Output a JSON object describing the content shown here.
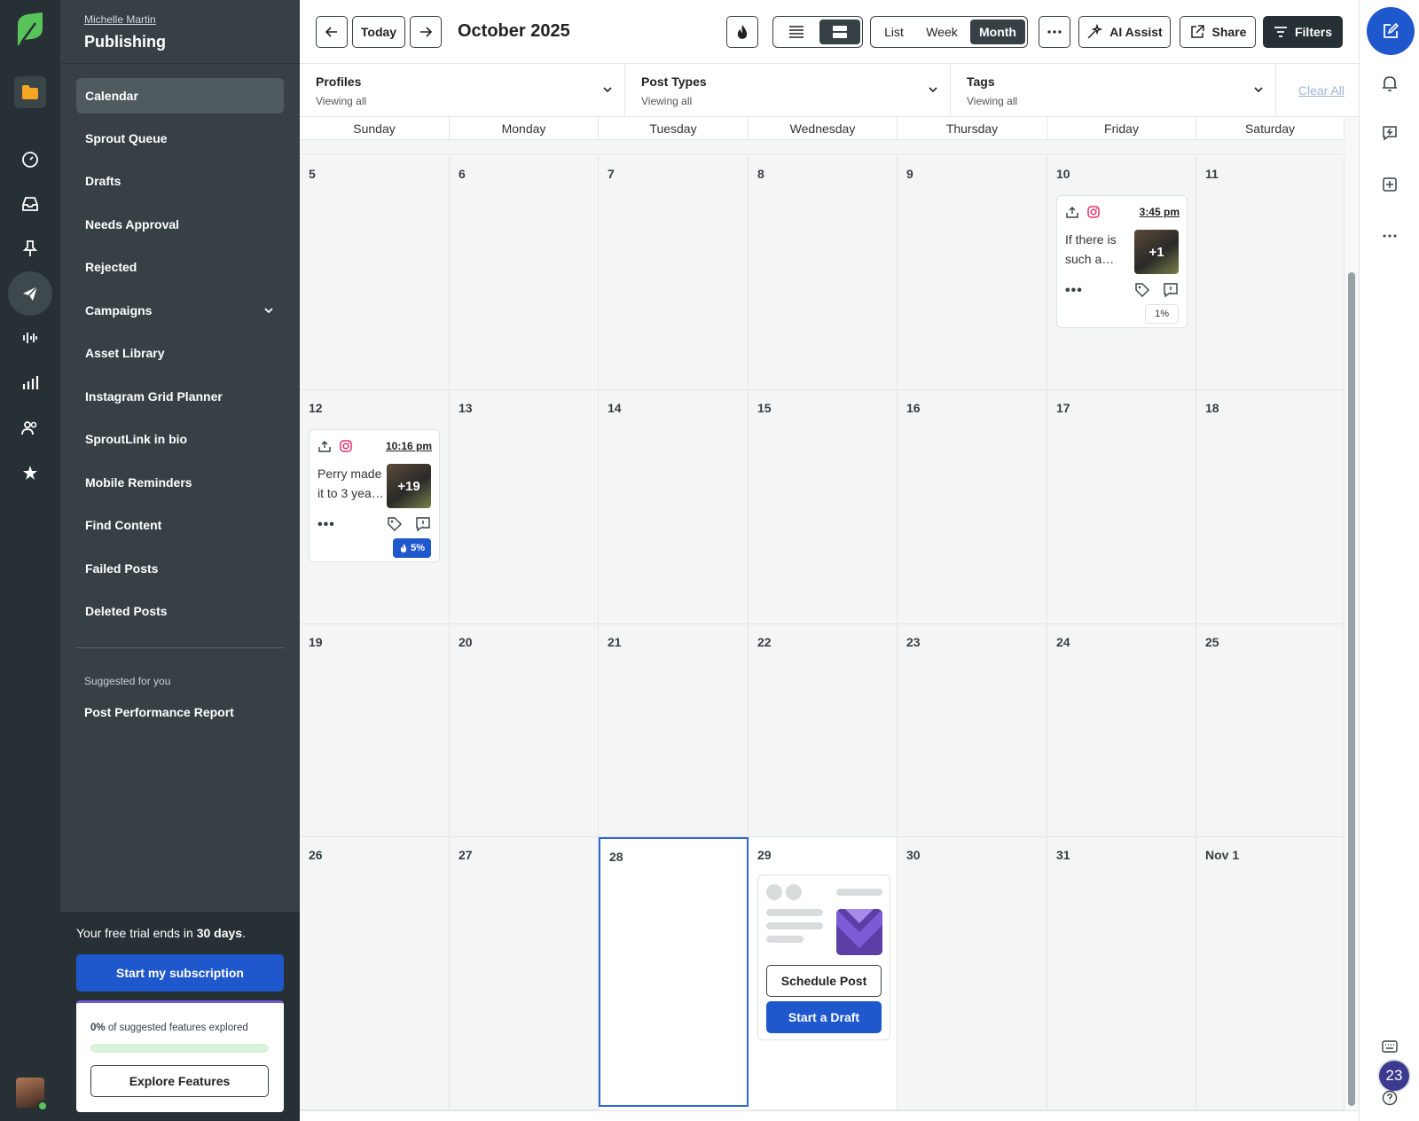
{
  "user": {
    "name": "Michelle Martin"
  },
  "sidebar": {
    "title": "Publishing",
    "items": [
      {
        "label": "Calendar"
      },
      {
        "label": "Sprout Queue"
      },
      {
        "label": "Drafts"
      },
      {
        "label": "Needs Approval"
      },
      {
        "label": "Rejected"
      },
      {
        "label": "Campaigns"
      },
      {
        "label": "Asset Library"
      },
      {
        "label": "Instagram Grid Planner"
      },
      {
        "label": "SproutLink in bio"
      },
      {
        "label": "Mobile Reminders"
      },
      {
        "label": "Find Content"
      },
      {
        "label": "Failed Posts"
      },
      {
        "label": "Deleted Posts"
      }
    ],
    "suggested_label": "Suggested for you",
    "suggested_item": "Post Performance Report"
  },
  "trial": {
    "prefix": "Your free trial ends in ",
    "days": "30 days",
    "suffix": ".",
    "subscribe_label": "Start my subscription",
    "explored_pct": "0%",
    "explored_rest": " of suggested features explored",
    "explored_value": 0,
    "explore_label": "Explore Features"
  },
  "toolbar": {
    "today_label": "Today",
    "title": "October 2025",
    "view_options": [
      "List",
      "Week",
      "Month"
    ],
    "selected_view": "Month",
    "ai_assist_label": "AI Assist",
    "share_label": "Share",
    "filters_label": "Filters"
  },
  "filters": [
    {
      "label": "Profiles",
      "sub": "Viewing all"
    },
    {
      "label": "Post Types",
      "sub": "Viewing all"
    },
    {
      "label": "Tags",
      "sub": "Viewing all"
    }
  ],
  "clear_all_label": "Clear All",
  "calendar": {
    "weekdays": [
      "Sunday",
      "Monday",
      "Tuesday",
      "Wednesday",
      "Thursday",
      "Friday",
      "Saturday"
    ],
    "weeks": [
      [
        "5",
        "6",
        "7",
        "8",
        "9",
        "10",
        "11"
      ],
      [
        "12",
        "13",
        "14",
        "15",
        "16",
        "17",
        "18"
      ],
      [
        "19",
        "20",
        "21",
        "22",
        "23",
        "24",
        "25"
      ],
      [
        "26",
        "27",
        "28",
        "29",
        "30",
        "31",
        "Nov 1"
      ]
    ],
    "today": "28",
    "posts": [
      {
        "day": "10",
        "time": "3:45 pm",
        "text": "If there is such a…",
        "media_count": "+1",
        "performance": "1%",
        "hot": false
      },
      {
        "day": "12",
        "time": "10:16 pm",
        "text": "Perry made it to 3 yea…",
        "media_count": "+19",
        "performance": "5%",
        "hot": true
      }
    ],
    "empty_day": {
      "schedule_label": "Schedule Post",
      "draft_label": "Start a Draft"
    }
  },
  "notifications": {
    "badge_count": "23"
  },
  "colors": {
    "brand_blue": "#1f57cc",
    "sidebar": "#364045",
    "rail": "#273135",
    "brand_green": "#59c45a"
  }
}
